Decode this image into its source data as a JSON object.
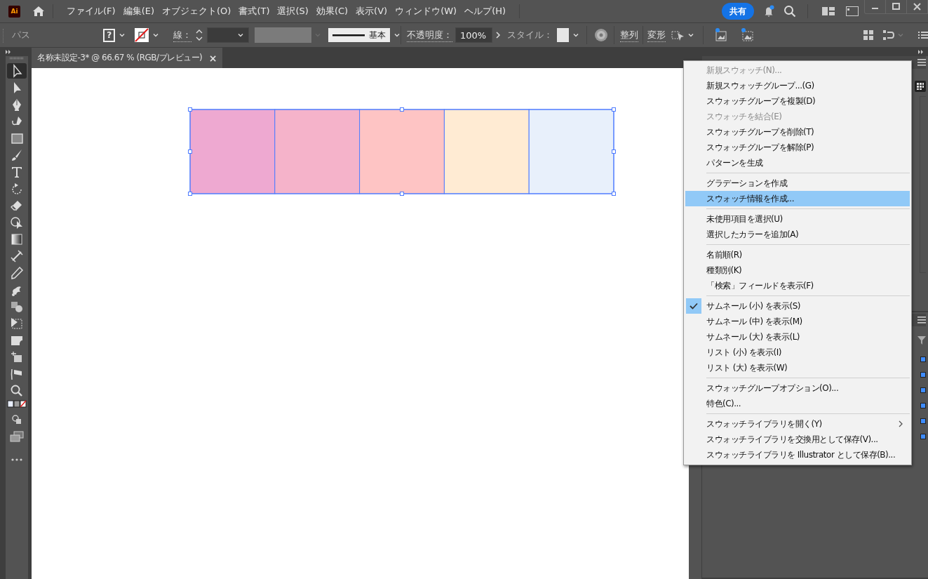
{
  "menu_bar": {
    "logo": "Ai",
    "items": [
      "ファイル(F)",
      "編集(E)",
      "オブジェクト(O)",
      "書式(T)",
      "選択(S)",
      "効果(C)",
      "表示(V)",
      "ウィンドウ(W)",
      "ヘルプ(H)"
    ],
    "share": "共有"
  },
  "control_bar": {
    "title": "パス",
    "fill_symbol": "?",
    "stroke_label": "線：",
    "brush": "基本",
    "opacity_label": "不透明度：",
    "opacity": "100%",
    "style_label": "スタイル：",
    "align": "整列",
    "transform": "変形"
  },
  "toolbar": {
    "tools": [
      {
        "selected": true
      },
      {
        "selected": false
      },
      {
        "selected": false
      },
      {
        "selected": false
      },
      {
        "selected": false
      },
      {
        "selected": false
      },
      {
        "selected": false
      },
      {
        "selected": false
      },
      {
        "selected": false
      },
      {
        "selected": false
      },
      {
        "selected": false
      },
      {
        "selected": false
      },
      {
        "selected": false
      },
      {
        "selected": false
      },
      {
        "selected": false
      },
      {
        "selected": false
      },
      {
        "selected": false
      },
      {
        "selected": false
      },
      {
        "selected": false
      },
      {
        "selected": false
      }
    ]
  },
  "document_tab": {
    "title": "名称未設定-3* @ 66.67 % (RGB/プレビュー)",
    "close": "×"
  },
  "artboard": {
    "selected": true,
    "rectangles": [
      {
        "color": "#eea9d1"
      },
      {
        "color": "#f5b3ca"
      },
      {
        "color": "#fec4c4"
      },
      {
        "color": "#ffebd3"
      },
      {
        "color": "#e8f0fb"
      }
    ]
  },
  "swatch_menu": {
    "items": [
      {
        "kind": "item",
        "label": "新規スウォッチ(N)...",
        "disabled": true,
        "selected": false,
        "checked": false,
        "submenu": false
      },
      {
        "kind": "item",
        "label": "新規スウォッチグループ...(G)",
        "disabled": false,
        "selected": false,
        "checked": false,
        "submenu": false
      },
      {
        "kind": "item",
        "label": "スウォッチグループを複製(D)",
        "disabled": false,
        "selected": false,
        "checked": false,
        "submenu": false
      },
      {
        "kind": "item",
        "label": "スウォッチを結合(E)",
        "disabled": true,
        "selected": false,
        "checked": false,
        "submenu": false
      },
      {
        "kind": "item",
        "label": "スウォッチグループを削除(T)",
        "disabled": false,
        "selected": false,
        "checked": false,
        "submenu": false
      },
      {
        "kind": "item",
        "label": "スウォッチグループを解除(P)",
        "disabled": false,
        "selected": false,
        "checked": false,
        "submenu": false
      },
      {
        "kind": "item",
        "label": "パターンを生成",
        "disabled": false,
        "selected": false,
        "checked": false,
        "submenu": false
      },
      {
        "kind": "separator"
      },
      {
        "kind": "item",
        "label": "グラデーションを作成",
        "disabled": false,
        "selected": false,
        "checked": false,
        "submenu": false
      },
      {
        "kind": "item",
        "label": "スウォッチ情報を作成...",
        "disabled": false,
        "selected": true,
        "checked": false,
        "submenu": false
      },
      {
        "kind": "separator"
      },
      {
        "kind": "item",
        "label": "未使用項目を選択(U)",
        "disabled": false,
        "selected": false,
        "checked": false,
        "submenu": false
      },
      {
        "kind": "item",
        "label": "選択したカラーを追加(A)",
        "disabled": false,
        "selected": false,
        "checked": false,
        "submenu": false
      },
      {
        "kind": "separator"
      },
      {
        "kind": "item",
        "label": "名前順(R)",
        "disabled": false,
        "selected": false,
        "checked": false,
        "submenu": false
      },
      {
        "kind": "item",
        "label": "種類別(K)",
        "disabled": false,
        "selected": false,
        "checked": false,
        "submenu": false
      },
      {
        "kind": "item",
        "label": "「検索」フィールドを表示(F)",
        "disabled": false,
        "selected": false,
        "checked": false,
        "submenu": false
      },
      {
        "kind": "separator"
      },
      {
        "kind": "item",
        "label": "サムネール (小) を表示(S)",
        "disabled": false,
        "selected": false,
        "checked": true,
        "submenu": false
      },
      {
        "kind": "item",
        "label": "サムネール (中) を表示(M)",
        "disabled": false,
        "selected": false,
        "checked": false,
        "submenu": false
      },
      {
        "kind": "item",
        "label": "サムネール (大) を表示(L)",
        "disabled": false,
        "selected": false,
        "checked": false,
        "submenu": false
      },
      {
        "kind": "item",
        "label": "リスト (小) を表示(I)",
        "disabled": false,
        "selected": false,
        "checked": false,
        "submenu": false
      },
      {
        "kind": "item",
        "label": "リスト (大) を表示(W)",
        "disabled": false,
        "selected": false,
        "checked": false,
        "submenu": false
      },
      {
        "kind": "separator"
      },
      {
        "kind": "item",
        "label": "スウォッチグループオプション(O)...",
        "disabled": false,
        "selected": false,
        "checked": false,
        "submenu": false
      },
      {
        "kind": "item",
        "label": "特色(C)...",
        "disabled": false,
        "selected": false,
        "checked": false,
        "submenu": false
      },
      {
        "kind": "separator"
      },
      {
        "kind": "item",
        "label": "スウォッチライブラリを開く(Y)",
        "disabled": false,
        "selected": false,
        "checked": false,
        "submenu": true
      },
      {
        "kind": "item",
        "label": "スウォッチライブラリを交換用として保存(V)...",
        "disabled": false,
        "selected": false,
        "checked": false,
        "submenu": false
      },
      {
        "kind": "item",
        "label": "スウォッチライブラリを Illustrator として保存(B)...",
        "disabled": false,
        "selected": false,
        "checked": false,
        "submenu": false
      }
    ]
  }
}
